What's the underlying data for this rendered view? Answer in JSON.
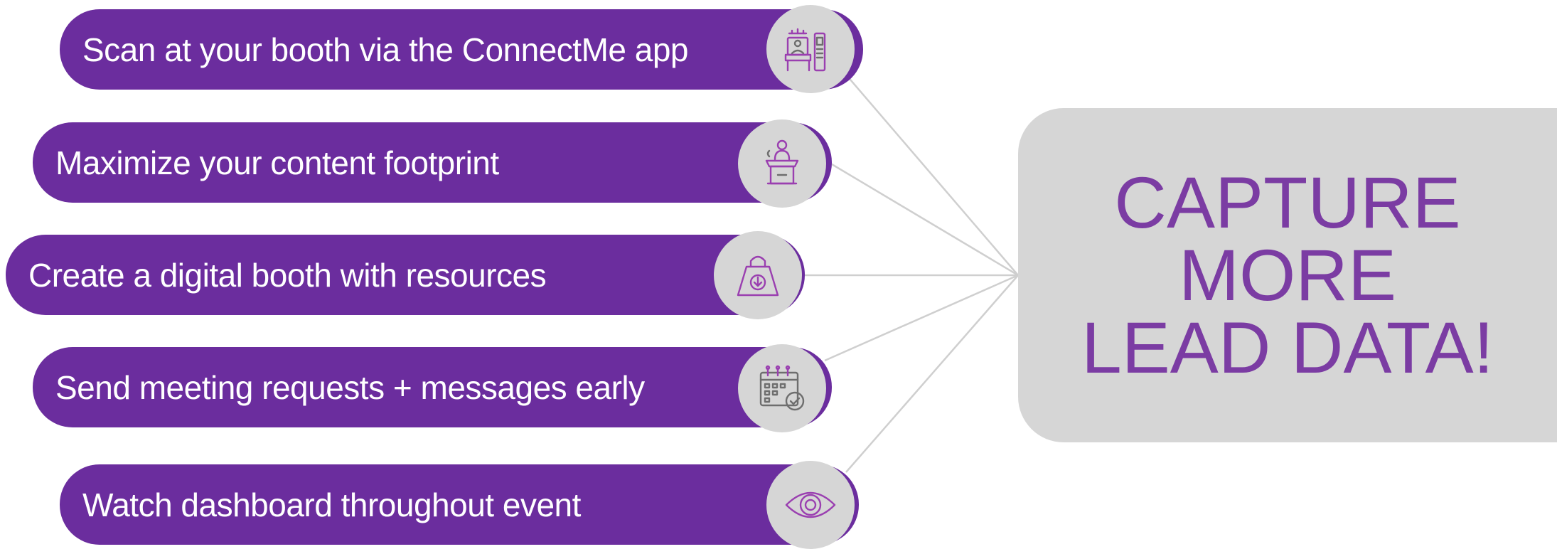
{
  "items": [
    {
      "label": "Scan at your booth via the ConnectMe app",
      "icon": "booth-kiosk-icon"
    },
    {
      "label": "Maximize your content footprint",
      "icon": "speaker-podium-icon"
    },
    {
      "label": "Create a digital booth with resources",
      "icon": "download-bag-icon"
    },
    {
      "label": "Send meeting requests + messages early",
      "icon": "calendar-check-icon"
    },
    {
      "label": "Watch dashboard throughout event",
      "icon": "eye-icon"
    }
  ],
  "callout": {
    "lines": [
      "CAPTURE",
      "MORE",
      "LEAD DATA!"
    ]
  },
  "colors": {
    "pill": "#6b2d9e",
    "circle": "#d6d6d6",
    "callout_bg": "#d6d6d6",
    "callout_text": "#7b3ca3",
    "icon_stroke": "#9a3fb0",
    "connector": "#cfcfcf"
  }
}
